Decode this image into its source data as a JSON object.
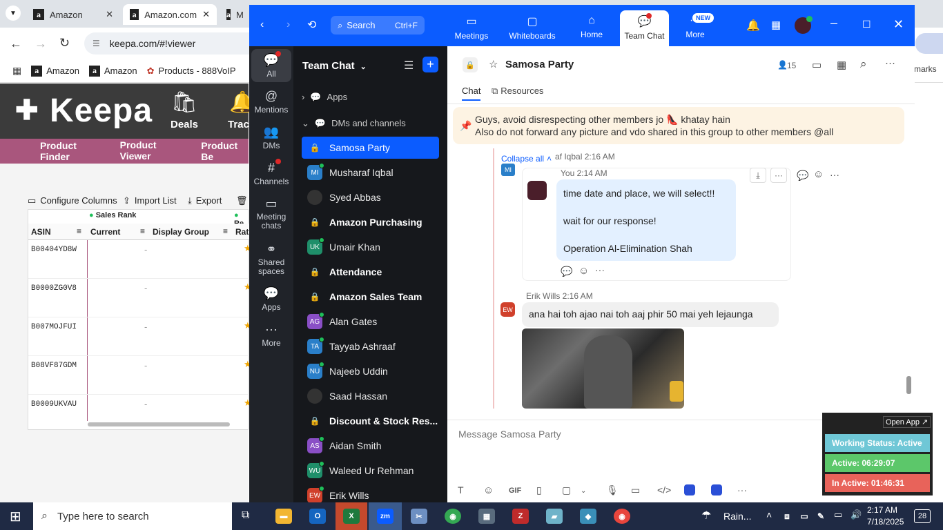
{
  "browser": {
    "tabs": [
      {
        "label": "Amazon",
        "close": "✕"
      },
      {
        "label": "Amazon.com",
        "close": "✕"
      },
      {
        "label": "M"
      }
    ],
    "url": "keepa.com/#!viewer",
    "bookmarks": [
      "Amazon",
      "Amazon",
      "Products - 888VoIP"
    ],
    "bookmark_right": "marks"
  },
  "keepa": {
    "logo": "Keepa",
    "deals": "Deals",
    "track": "Track",
    "nav": [
      "Product Finder",
      "Product Viewer",
      "Product Be"
    ],
    "toolbar": {
      "configure": "Configure Columns",
      "import": "Import List",
      "export": "Export"
    },
    "group_header": "Sales Rank",
    "group_header2": "Re",
    "columns": [
      "ASIN",
      "Current",
      "Display Group",
      "Rati"
    ],
    "rows": [
      {
        "asin": "B00404YD8W",
        "current": "-"
      },
      {
        "asin": "B0000ZG0V8",
        "current": "-"
      },
      {
        "asin": "B007MOJFUI",
        "current": "-"
      },
      {
        "asin": "B08VF87GDM",
        "current": "-"
      },
      {
        "asin": "B0009UKVAU",
        "current": "-"
      }
    ]
  },
  "zoom": {
    "search": "Search",
    "search_shortcut": "Ctrl+F",
    "header_tabs": [
      "Meetings",
      "Whiteboards",
      "Home",
      "Team Chat",
      "More"
    ],
    "new_badge": "NEW",
    "rail": [
      "All",
      "Mentions",
      "DMs",
      "Channels",
      "Meeting chats",
      "Shared spaces",
      "Apps",
      "More"
    ],
    "sidebar_title": "Team Chat",
    "apps_label": "Apps",
    "dms_label": "DMs and channels",
    "channels": [
      {
        "name": "Samosa Party",
        "kind": "lock",
        "selected": true
      },
      {
        "name": "Musharaf Iqbal",
        "kind": "avatar",
        "initials": "MI",
        "color": "#2a7fc9"
      },
      {
        "name": "Syed Abbas",
        "kind": "photo"
      },
      {
        "name": "Amazon Purchasing",
        "kind": "lock",
        "bold": true
      },
      {
        "name": "Umair Khan",
        "kind": "avatar",
        "initials": "UK",
        "color": "#1f8f6a"
      },
      {
        "name": "Attendance",
        "kind": "lock",
        "bold": true
      },
      {
        "name": "Amazon Sales Team",
        "kind": "lock",
        "bold": true
      },
      {
        "name": "Alan Gates",
        "kind": "avatar",
        "initials": "AG",
        "color": "#8a4fc6"
      },
      {
        "name": "Tayyab Ashraaf",
        "kind": "avatar",
        "initials": "TA",
        "color": "#2a7fc9"
      },
      {
        "name": "Najeeb Uddin",
        "kind": "avatar",
        "initials": "NU",
        "color": "#2a7fc9"
      },
      {
        "name": "Saad Hassan",
        "kind": "photo"
      },
      {
        "name": "Discount & Stock Res...",
        "kind": "lock",
        "bold": true
      },
      {
        "name": "Aidan Smith",
        "kind": "avatar",
        "initials": "AS",
        "color": "#8a4fc6"
      },
      {
        "name": "Waleed Ur Rehman",
        "kind": "avatar",
        "initials": "WU",
        "color": "#1f8f6a"
      },
      {
        "name": "Erik Wills",
        "kind": "avatar",
        "initials": "EW",
        "color": "#d0402b"
      }
    ],
    "chat_title": "Samosa Party",
    "member_count": "15",
    "subtabs": [
      "Chat",
      "Resources"
    ],
    "pinned": {
      "line1": "Guys, avoid disrespecting other members jo 👠 khatay hain",
      "line2": "Also do not forward any picture and vdo shared in this group to other members @all"
    },
    "collapse_all": "Collapse all",
    "thread_head": "af Iqbal 2:16 AM",
    "mi_initials": "MI",
    "you_label": "You 2:14 AM",
    "my_message": [
      "time date and place, we will select!!",
      "wait for our response!",
      "Operation Al-Elimination Shah"
    ],
    "erik_header": "Erik Wills 2:16 AM",
    "erik_initials": "EW",
    "erik_message": "ana hai toh ajao nai toh aaj phir 50 mai yeh lejaunga",
    "composer_placeholder": "Message Samosa Party"
  },
  "status_widget": {
    "open_app": "Open App ↗",
    "working": "Working Status: Active",
    "active": "Active: 06:29:07",
    "inactive": "In Active: 01:46:31"
  },
  "taskbar": {
    "search_placeholder": "Type here to search",
    "weather": "Rain...",
    "time": "2:17 AM",
    "date": "7/18/2025",
    "notif": "28"
  }
}
